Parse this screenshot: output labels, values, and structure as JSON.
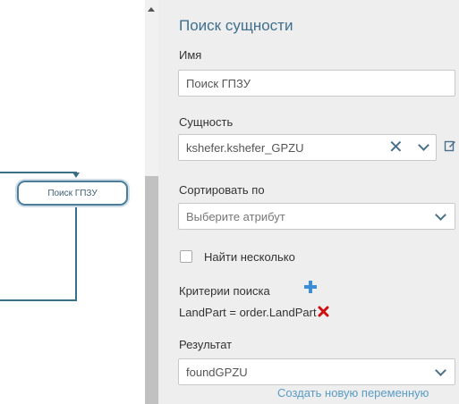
{
  "canvas": {
    "node_label": "Поиск ГПЗУ"
  },
  "panel": {
    "title": "Поиск сущности",
    "name_label": "Имя",
    "name_value": "Поиск ГПЗУ",
    "entity_label": "Сущность",
    "entity_value": "kshefer.kshefer_GPZU",
    "sort_label": "Сортировать по",
    "sort_placeholder": "Выберите атрибут",
    "find_multiple_label": "Найти несколько",
    "criteria_label": "Критерии поиска",
    "criteria_item": "LandPart = order.LandPart",
    "result_label": "Результат",
    "result_value": "foundGPZU",
    "create_variable_link": "Создать новую переменную"
  },
  "icons": {
    "clear": "close-icon",
    "dropdown": "chevron-down-icon",
    "edit": "edit-icon",
    "add": "plus-icon",
    "remove": "remove-icon",
    "scroll_up": "scroll-up-arrow-icon"
  },
  "colors": {
    "accent": "#3e6f8d",
    "link": "#5a9cc4",
    "plus": "#3a8ed8",
    "remove": "#d01010",
    "panel_bg": "#eeeeee"
  }
}
